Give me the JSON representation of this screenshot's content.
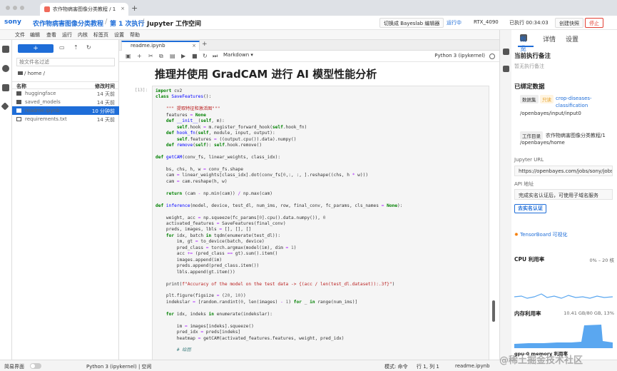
{
  "browser": {
    "tab_title": "农作物病害图像分类教程 / 1",
    "close": "×",
    "new_tab": "+"
  },
  "header": {
    "logo": "sony",
    "project": "农作物病害图像分类教程",
    "sep1": "/",
    "run": "第 1 次执行",
    "sep2": "/",
    "workspace": "Jupyter 工作空间",
    "switch_editor": "切换成 Bayeslab 编辑器",
    "status": "运行中",
    "gpu": "RTX_4090",
    "elapsed": "已执行 00:34:03",
    "create_snapshot": "创建快照",
    "stop": "停止"
  },
  "menu": [
    "文件",
    "编辑",
    "查看",
    "运行",
    "内核",
    "标签页",
    "设置",
    "帮助"
  ],
  "filebrowser": {
    "new_label": "+",
    "search_placeholder": "按文件名过滤",
    "path": "/ home /",
    "col_name": "名称",
    "col_modified": "修改时间",
    "files": [
      {
        "name": "huggingface",
        "modified": "14 天前",
        "type": "folder"
      },
      {
        "name": "saved_models",
        "modified": "14 天前",
        "type": "folder"
      },
      {
        "name": "readme.ipynb",
        "modified": "10 分钟前",
        "type": "notebook",
        "selected": true
      },
      {
        "name": "requirements.txt",
        "modified": "14 天前",
        "type": "file"
      }
    ]
  },
  "notebook": {
    "tab_name": "readme.ipynb",
    "close": "×",
    "plus": "+",
    "cell_type": "Markdown",
    "kernel": "Python 3 (ipykernel)",
    "heading": "推理并使用 GradCAM 进行 AI 模型性能分析",
    "prompt": "[13]:",
    "toolbar": [
      "▣",
      "+",
      "✂",
      "⧉",
      "▤",
      "▶",
      "■",
      "↻",
      "⏭"
    ]
  },
  "right_panel": {
    "tabs": [
      "概览",
      "详情",
      "设置"
    ],
    "current_note_title": "当前执行备注",
    "current_note_empty": "暂无执行备注",
    "bound_data_title": "已绑定数据",
    "dataset_badge": "数据集",
    "readonly_badge": "只读",
    "dataset_name": "crop-diseases-",
    "dataset_name2": "classification",
    "dataset_path": "/openbayes/input/input0",
    "workdir_badge": "工作目录",
    "workdir_name": "农作物病害图像分类教程/1",
    "workdir_path": "/openbayes/home",
    "jupyter_url_label": "Jupyter URL",
    "jupyter_url": "https://openbayes.com/jobs/sony/jobs",
    "api_label": "API 地址",
    "api_text": "完成实名认证后，可使用子域名服务",
    "verify_btn": "去实名认证",
    "tensorboard": "TensorBoard 可视化",
    "cpu_title": "CPU 利用率",
    "cpu_value": "0% – 20 核",
    "mem_title": "内存利用率",
    "mem_value": "10.41 GB/80 GB, 13%",
    "gpu_title": "gpu-0 memory 利用率"
  },
  "statusbar": {
    "mode_label": "简易界面",
    "kernel": "Python 3 (ipykernel) | 空闲",
    "mode": "模式: 命令",
    "position": "行 1, 列 1",
    "file": "readme.ipynb"
  },
  "watermark": "@稀土掘金技术社区",
  "colors": {
    "accent": "#1e6dd8",
    "stop": "#e33e33",
    "status": "#1e6dd8"
  }
}
